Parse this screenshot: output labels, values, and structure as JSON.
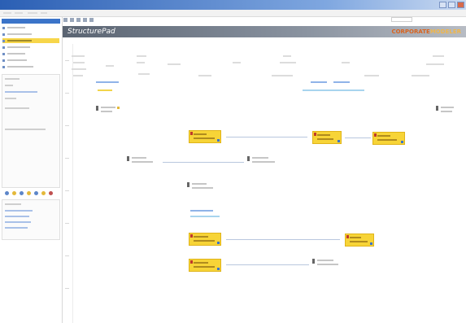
{
  "window": {
    "title": "",
    "buttons": [
      "minimize",
      "maximize",
      "close"
    ]
  },
  "menu": {
    "items": []
  },
  "banner": {
    "app_name": "StructurePad",
    "logo_text": "CORPORATE",
    "logo_accent": "MODELER",
    "brand_color": "#d9641f"
  },
  "sidebar": {
    "items": [
      {
        "label": "",
        "active": false
      },
      {
        "label": "",
        "active": false
      },
      {
        "label": "",
        "active": true
      },
      {
        "label": "",
        "active": false
      },
      {
        "label": "",
        "active": false
      },
      {
        "label": "",
        "active": false
      },
      {
        "label": "",
        "active": false
      }
    ],
    "tools": [
      "tool-icon",
      "tool-icon",
      "tool-icon",
      "tool-icon",
      "tool-icon",
      "tool-icon",
      "tool-icon"
    ]
  },
  "diagram": {
    "highlight_color": "#f7d437",
    "link_color": "#3b74c9",
    "nodes": []
  }
}
